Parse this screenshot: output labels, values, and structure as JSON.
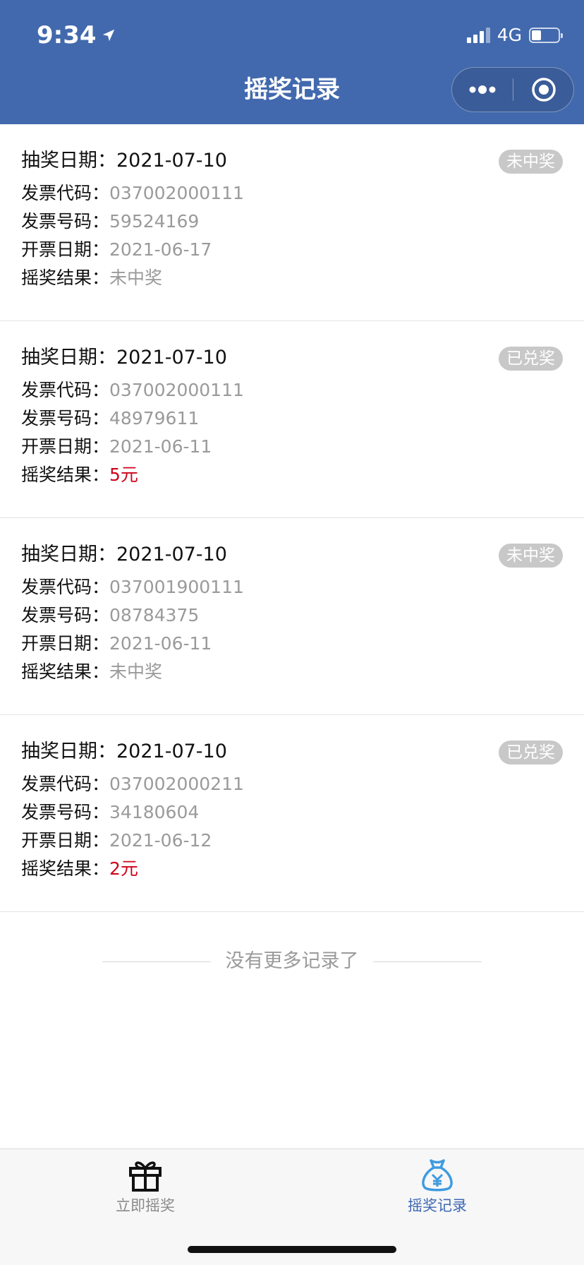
{
  "status_bar": {
    "time": "9:34",
    "network": "4G",
    "battery_level": 0.35
  },
  "nav": {
    "title": "摇奖记录",
    "capsule_more_icon": "more-dots-icon",
    "capsule_target_icon": "target-icon"
  },
  "labels": {
    "draw_date": "抽奖日期：",
    "invoice_code": "发票代码：",
    "invoice_number": "发票号码：",
    "issue_date": "开票日期：",
    "result": "摇奖结果："
  },
  "records": [
    {
      "draw_date": "2021-07-10",
      "status": "未中奖",
      "invoice_code": "037002000111",
      "invoice_number": "59524169",
      "issue_date": "2021-06-17",
      "result": "未中奖",
      "won": false
    },
    {
      "draw_date": "2021-07-10",
      "status": "已兑奖",
      "invoice_code": "037002000111",
      "invoice_number": "48979611",
      "issue_date": "2021-06-11",
      "result": "5元",
      "won": true
    },
    {
      "draw_date": "2021-07-10",
      "status": "未中奖",
      "invoice_code": "037001900111",
      "invoice_number": "08784375",
      "issue_date": "2021-06-11",
      "result": "未中奖",
      "won": false
    },
    {
      "draw_date": "2021-07-10",
      "status": "已兑奖",
      "invoice_code": "037002000211",
      "invoice_number": "34180604",
      "issue_date": "2021-06-12",
      "result": "2元",
      "won": true
    }
  ],
  "footer_text": "没有更多记录了",
  "tabbar": {
    "tabs": [
      {
        "label": "立即摇奖",
        "icon": "gift-icon",
        "active": false
      },
      {
        "label": "摇奖记录",
        "icon": "money-bag-icon",
        "active": true
      }
    ]
  },
  "colors": {
    "header": "#4269ad",
    "prize": "#d0021b",
    "active_tab": "#3e68b3",
    "badge": "#c8c8c8"
  }
}
